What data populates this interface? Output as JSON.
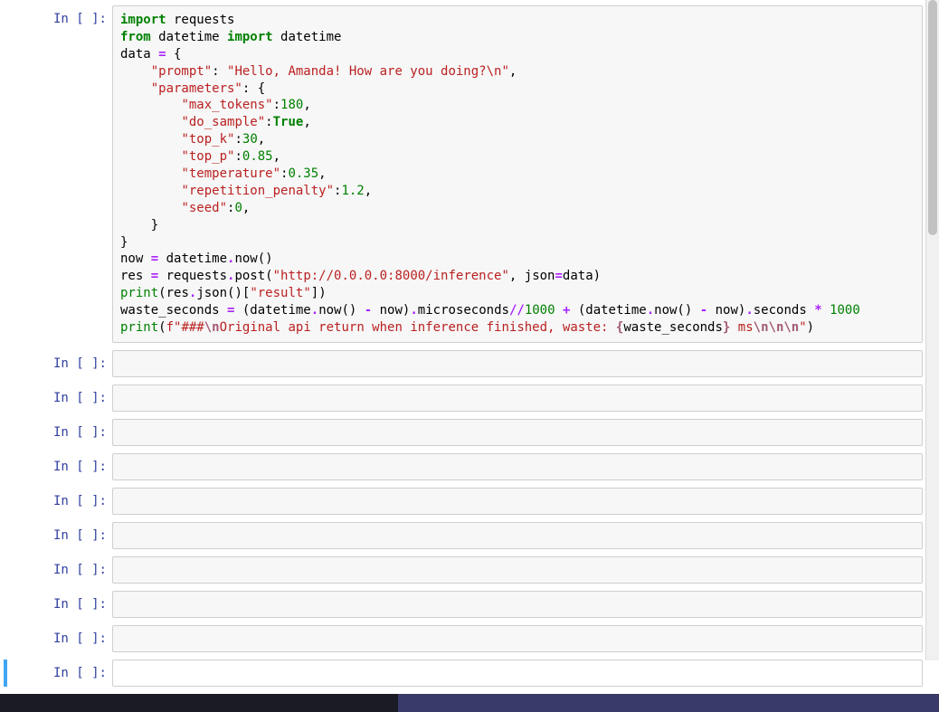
{
  "cells": [
    {
      "prompt": "In [ ]:",
      "kind": "code",
      "code_tokens": [
        {
          "t": "import",
          "c": "kw"
        },
        {
          "t": " requests\n"
        },
        {
          "t": "from",
          "c": "kw"
        },
        {
          "t": " datetime "
        },
        {
          "t": "import",
          "c": "kw"
        },
        {
          "t": " datetime\n"
        },
        {
          "t": "data "
        },
        {
          "t": "=",
          "c": "op"
        },
        {
          "t": " {\n"
        },
        {
          "t": "    "
        },
        {
          "t": "\"prompt\"",
          "c": "str"
        },
        {
          "t": ": "
        },
        {
          "t": "\"Hello, Amanda! How are you doing?\\n\"",
          "c": "str"
        },
        {
          "t": ",\n"
        },
        {
          "t": "    "
        },
        {
          "t": "\"parameters\"",
          "c": "str"
        },
        {
          "t": ": {\n"
        },
        {
          "t": "        "
        },
        {
          "t": "\"max_tokens\"",
          "c": "str"
        },
        {
          "t": ":"
        },
        {
          "t": "180",
          "c": "num"
        },
        {
          "t": ",\n"
        },
        {
          "t": "        "
        },
        {
          "t": "\"do_sample\"",
          "c": "str"
        },
        {
          "t": ":"
        },
        {
          "t": "True",
          "c": "bool"
        },
        {
          "t": ",\n"
        },
        {
          "t": "        "
        },
        {
          "t": "\"top_k\"",
          "c": "str"
        },
        {
          "t": ":"
        },
        {
          "t": "30",
          "c": "num"
        },
        {
          "t": ",\n"
        },
        {
          "t": "        "
        },
        {
          "t": "\"top_p\"",
          "c": "str"
        },
        {
          "t": ":"
        },
        {
          "t": "0.85",
          "c": "num"
        },
        {
          "t": ",\n"
        },
        {
          "t": "        "
        },
        {
          "t": "\"temperature\"",
          "c": "str"
        },
        {
          "t": ":"
        },
        {
          "t": "0.35",
          "c": "num"
        },
        {
          "t": ",\n"
        },
        {
          "t": "        "
        },
        {
          "t": "\"repetition_penalty\"",
          "c": "str"
        },
        {
          "t": ":"
        },
        {
          "t": "1.2",
          "c": "num"
        },
        {
          "t": ",\n"
        },
        {
          "t": "        "
        },
        {
          "t": "\"seed\"",
          "c": "str"
        },
        {
          "t": ":"
        },
        {
          "t": "0",
          "c": "num"
        },
        {
          "t": ",\n"
        },
        {
          "t": "    }\n"
        },
        {
          "t": "}\n"
        },
        {
          "t": "now "
        },
        {
          "t": "=",
          "c": "op"
        },
        {
          "t": " datetime"
        },
        {
          "t": ".",
          "c": "op"
        },
        {
          "t": "now()\n"
        },
        {
          "t": "res "
        },
        {
          "t": "=",
          "c": "op"
        },
        {
          "t": " requests"
        },
        {
          "t": ".",
          "c": "op"
        },
        {
          "t": "post("
        },
        {
          "t": "\"http://0.0.0.0:8000/inference\"",
          "c": "str"
        },
        {
          "t": ", json"
        },
        {
          "t": "=",
          "c": "op"
        },
        {
          "t": "data)\n"
        },
        {
          "t": "print",
          "c": "bn"
        },
        {
          "t": "(res"
        },
        {
          "t": ".",
          "c": "op"
        },
        {
          "t": "json()["
        },
        {
          "t": "\"result\"",
          "c": "str"
        },
        {
          "t": "])\n"
        },
        {
          "t": "waste_seconds "
        },
        {
          "t": "=",
          "c": "op"
        },
        {
          "t": " (datetime"
        },
        {
          "t": ".",
          "c": "op"
        },
        {
          "t": "now() "
        },
        {
          "t": "-",
          "c": "op"
        },
        {
          "t": " now)"
        },
        {
          "t": ".",
          "c": "op"
        },
        {
          "t": "microseconds"
        },
        {
          "t": "//",
          "c": "op"
        },
        {
          "t": "1000",
          "c": "num"
        },
        {
          "t": " "
        },
        {
          "t": "+",
          "c": "op"
        },
        {
          "t": " (datetime"
        },
        {
          "t": ".",
          "c": "op"
        },
        {
          "t": "now() "
        },
        {
          "t": "-",
          "c": "op"
        },
        {
          "t": " now)"
        },
        {
          "t": ".",
          "c": "op"
        },
        {
          "t": "seconds "
        },
        {
          "t": "*",
          "c": "op"
        },
        {
          "t": " "
        },
        {
          "t": "1000",
          "c": "num"
        },
        {
          "t": "\n"
        },
        {
          "t": "print",
          "c": "bn"
        },
        {
          "t": "("
        },
        {
          "t": "f\"###",
          "c": "str"
        },
        {
          "t": "\\n",
          "c": "si"
        },
        {
          "t": "Original api return when inference finished, waste: ",
          "c": "str"
        },
        {
          "t": "{",
          "c": "si"
        },
        {
          "t": "waste_seconds"
        },
        {
          "t": "}",
          "c": "si"
        },
        {
          "t": " ms",
          "c": "str"
        },
        {
          "t": "\\n\\n\\n",
          "c": "si"
        },
        {
          "t": "\"",
          "c": "str"
        },
        {
          "t": ")"
        }
      ]
    },
    {
      "prompt": "In [ ]:",
      "kind": "empty"
    },
    {
      "prompt": "In [ ]:",
      "kind": "empty"
    },
    {
      "prompt": "In [ ]:",
      "kind": "empty"
    },
    {
      "prompt": "In [ ]:",
      "kind": "empty"
    },
    {
      "prompt": "In [ ]:",
      "kind": "empty"
    },
    {
      "prompt": "In [ ]:",
      "kind": "empty"
    },
    {
      "prompt": "In [ ]:",
      "kind": "empty"
    },
    {
      "prompt": "In [ ]:",
      "kind": "empty"
    },
    {
      "prompt": "In [ ]:",
      "kind": "empty"
    },
    {
      "prompt": "In [ ]:",
      "kind": "empty",
      "selected": true
    }
  ]
}
